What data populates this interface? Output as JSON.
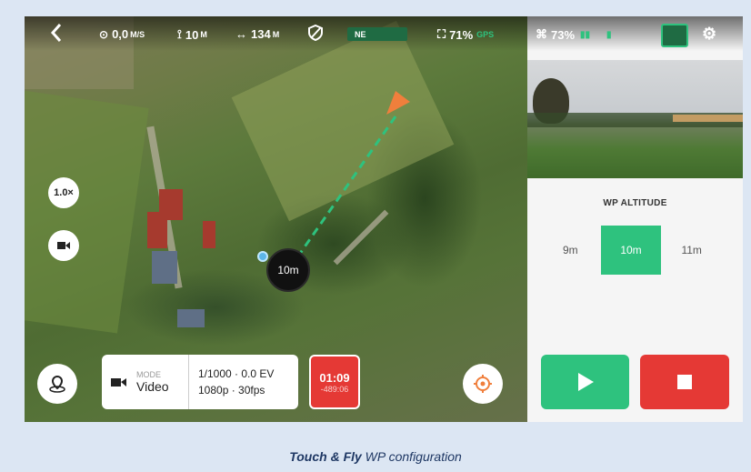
{
  "topbar": {
    "speed": "0,0",
    "speed_unit": "M/S",
    "altitude": "10",
    "altitude_unit": "M",
    "distance": "134",
    "distance_unit": "M",
    "heading": "NE",
    "drone_battery": "71%",
    "gps_label": "GPS",
    "remote_battery": "73%"
  },
  "map": {
    "zoom": "1.0×",
    "drone_altitude_label": "10m"
  },
  "camera_panel": {
    "mode_label": "MODE",
    "mode_value": "Video",
    "exposure": "1/1000 · 0.0 EV",
    "resolution": "1080p · 30fps"
  },
  "record": {
    "time": "01:09",
    "remaining": "-489:06"
  },
  "wp": {
    "title": "WP ALTITUDE",
    "options": [
      "9m",
      "10m",
      "11m"
    ],
    "selected": "10m"
  },
  "caption": {
    "bold": "Touch & Fly",
    "rest": " WP configuration"
  },
  "colors": {
    "accent_green": "#2ec27e",
    "stop_red": "#e53935",
    "caption_blue": "#1f3864"
  }
}
